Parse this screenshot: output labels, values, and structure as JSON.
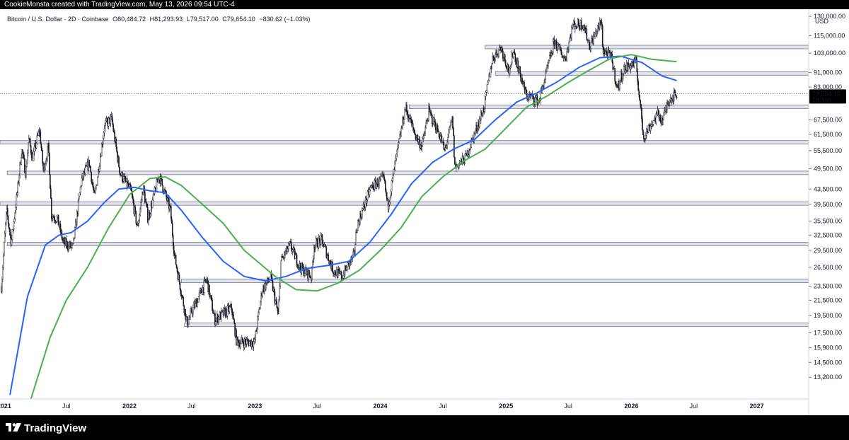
{
  "header": {
    "caption": "CookieMonsta created with TradingView.com, May 13, 2026 09:54 UTC-4"
  },
  "legend": {
    "symbol": "Bitcoin / U.S. Dollar · 2D · Coinbase",
    "open": "O80,484.72",
    "high": "H81,293.93",
    "low": "L79,517.00",
    "close": "C79,654.10",
    "change": "−830.62 (−1.03%)"
  },
  "price_scale": {
    "currency": "USD",
    "last_price": "79,654.10",
    "countdown": "1d 11h"
  },
  "footer": {
    "brand": "TradingView"
  },
  "colors": {
    "candle": "#131722",
    "ma_fast": "#2962ff",
    "ma_slow": "#4caf50",
    "level_fill": "#e0e3eb",
    "level_stroke": "#787b86",
    "badge": "#000000"
  },
  "chart_data": {
    "type": "candlestick",
    "scale": "log",
    "ylim": [
      11500,
      136000
    ],
    "xlim": [
      "2020-12-20",
      "2027-06-01"
    ],
    "y_ticks": [
      {
        "label": "130,000.00",
        "value": 130000
      },
      {
        "label": "115,000.00",
        "value": 115000
      },
      {
        "label": "103,000.00",
        "value": 103000
      },
      {
        "label": "91,000.00",
        "value": 91000
      },
      {
        "label": "83,000.00",
        "value": 83000
      },
      {
        "label": "67,500.00",
        "value": 67500
      },
      {
        "label": "61,500.00",
        "value": 61500
      },
      {
        "label": "55,500.00",
        "value": 55500
      },
      {
        "label": "49,500.00",
        "value": 49500
      },
      {
        "label": "43,500.00",
        "value": 43500
      },
      {
        "label": "39,500.00",
        "value": 39500
      },
      {
        "label": "35,500.00",
        "value": 35500
      },
      {
        "label": "32,500.00",
        "value": 32500
      },
      {
        "label": "29,500.00",
        "value": 29500
      },
      {
        "label": "26,500.00",
        "value": 26500
      },
      {
        "label": "23,500.00",
        "value": 23500
      },
      {
        "label": "21,500.00",
        "value": 21500
      },
      {
        "label": "19,500.00",
        "value": 19500
      },
      {
        "label": "17,500.00",
        "value": 17500
      },
      {
        "label": "15,900.00",
        "value": 15900
      },
      {
        "label": "14,500.00",
        "value": 14500
      },
      {
        "label": "13,200.00",
        "value": 13200
      }
    ],
    "x_ticks": [
      {
        "label": "2021",
        "date": "2021-01-01",
        "bold": true
      },
      {
        "label": "Jul",
        "date": "2021-07-01",
        "bold": false
      },
      {
        "label": "2022",
        "date": "2022-01-01",
        "bold": true
      },
      {
        "label": "Jul",
        "date": "2022-07-01",
        "bold": false
      },
      {
        "label": "2023",
        "date": "2023-01-01",
        "bold": true
      },
      {
        "label": "Jul",
        "date": "2023-07-01",
        "bold": false
      },
      {
        "label": "2024",
        "date": "2024-01-01",
        "bold": true
      },
      {
        "label": "Jul",
        "date": "2024-07-01",
        "bold": false
      },
      {
        "label": "2025",
        "date": "2025-01-01",
        "bold": true
      },
      {
        "label": "Jul",
        "date": "2025-07-01",
        "bold": false
      },
      {
        "label": "2026",
        "date": "2026-01-01",
        "bold": true
      },
      {
        "label": "Jul",
        "date": "2026-07-01",
        "bold": false
      },
      {
        "label": "2027",
        "date": "2027-01-01",
        "bold": true
      }
    ],
    "price_series": [
      [
        "2020-12-24",
        23500
      ],
      [
        "2021-01-08",
        38000
      ],
      [
        "2021-01-22",
        31000
      ],
      [
        "2021-02-10",
        44000
      ],
      [
        "2021-02-21",
        56000
      ],
      [
        "2021-03-05",
        48000
      ],
      [
        "2021-03-13",
        60000
      ],
      [
        "2021-03-25",
        53000
      ],
      [
        "2021-04-14",
        63500
      ],
      [
        "2021-04-25",
        49000
      ],
      [
        "2021-05-10",
        57000
      ],
      [
        "2021-05-19",
        37000
      ],
      [
        "2021-06-05",
        36000
      ],
      [
        "2021-06-22",
        31000
      ],
      [
        "2021-07-20",
        30000
      ],
      [
        "2021-08-14",
        46000
      ],
      [
        "2021-09-06",
        51500
      ],
      [
        "2021-09-21",
        41000
      ],
      [
        "2021-10-20",
        65000
      ],
      [
        "2021-11-10",
        68000
      ],
      [
        "2021-11-26",
        54000
      ],
      [
        "2021-12-05",
        48000
      ],
      [
        "2022-01-05",
        43000
      ],
      [
        "2022-01-24",
        34000
      ],
      [
        "2022-02-10",
        44000
      ],
      [
        "2022-02-24",
        36000
      ],
      [
        "2022-03-28",
        47500
      ],
      [
        "2022-04-30",
        38000
      ],
      [
        "2022-05-12",
        28500
      ],
      [
        "2022-06-18",
        18500
      ],
      [
        "2022-07-01",
        20000
      ],
      [
        "2022-08-14",
        24500
      ],
      [
        "2022-09-06",
        19000
      ],
      [
        "2022-10-25",
        20500
      ],
      [
        "2022-11-09",
        16500
      ],
      [
        "2022-12-31",
        16500
      ],
      [
        "2023-01-22",
        23000
      ],
      [
        "2023-02-16",
        24800
      ],
      [
        "2023-03-10",
        19500
      ],
      [
        "2023-03-18",
        27500
      ],
      [
        "2023-04-14",
        30500
      ],
      [
        "2023-05-12",
        26500
      ],
      [
        "2023-06-15",
        25000
      ],
      [
        "2023-06-22",
        30500
      ],
      [
        "2023-07-14",
        31500
      ],
      [
        "2023-08-17",
        26000
      ],
      [
        "2023-09-11",
        25000
      ],
      [
        "2023-10-16",
        28500
      ],
      [
        "2023-10-25",
        34500
      ],
      [
        "2023-12-05",
        44000
      ],
      [
        "2024-01-11",
        46500
      ],
      [
        "2024-01-23",
        39000
      ],
      [
        "2024-02-15",
        52000
      ],
      [
        "2024-03-14",
        73000
      ],
      [
        "2024-04-13",
        61000
      ],
      [
        "2024-05-01",
        57000
      ],
      [
        "2024-05-21",
        71000
      ],
      [
        "2024-06-25",
        60500
      ],
      [
        "2024-07-06",
        55000
      ],
      [
        "2024-07-29",
        68000
      ],
      [
        "2024-08-05",
        50000
      ],
      [
        "2024-09-06",
        53000
      ],
      [
        "2024-10-29",
        73000
      ],
      [
        "2024-11-22",
        99000
      ],
      [
        "2024-12-17",
        107000
      ],
      [
        "2025-01-13",
        90000
      ],
      [
        "2025-01-21",
        106000
      ],
      [
        "2025-02-28",
        79000
      ],
      [
        "2025-04-07",
        76000
      ],
      [
        "2025-05-22",
        111000
      ],
      [
        "2025-06-22",
        99000
      ],
      [
        "2025-07-14",
        123000
      ],
      [
        "2025-08-14",
        124000
      ],
      [
        "2025-09-01",
        108000
      ],
      [
        "2025-10-06",
        126000
      ],
      [
        "2025-10-10",
        105000
      ],
      [
        "2025-11-04",
        100000
      ],
      [
        "2025-11-21",
        82000
      ],
      [
        "2025-12-10",
        93000
      ],
      [
        "2026-01-14",
        97500
      ],
      [
        "2026-02-05",
        60500
      ],
      [
        "2026-03-01",
        66000
      ],
      [
        "2026-03-20",
        70000
      ],
      [
        "2026-04-01",
        67000
      ],
      [
        "2026-04-20",
        77000
      ],
      [
        "2026-05-13",
        79654
      ]
    ],
    "series": [
      {
        "color": "#2962ff",
        "points": [
          [
            "2021-01-18",
            11800
          ],
          [
            "2021-03-10",
            22000
          ],
          [
            "2021-05-01",
            30500
          ],
          [
            "2021-06-10",
            32500
          ],
          [
            "2021-07-15",
            33000
          ],
          [
            "2021-09-01",
            35500
          ],
          [
            "2021-10-20",
            40000
          ],
          [
            "2021-12-01",
            43500
          ],
          [
            "2022-01-15",
            44000
          ],
          [
            "2022-03-01",
            43000
          ],
          [
            "2022-04-15",
            42500
          ],
          [
            "2022-06-01",
            38000
          ],
          [
            "2022-08-01",
            32000
          ],
          [
            "2022-10-01",
            27500
          ],
          [
            "2022-12-01",
            25000
          ],
          [
            "2023-02-01",
            24300
          ],
          [
            "2023-04-01",
            25000
          ],
          [
            "2023-06-01",
            26300
          ],
          [
            "2023-08-01",
            26800
          ],
          [
            "2023-10-01",
            27500
          ],
          [
            "2023-12-01",
            31000
          ],
          [
            "2024-02-01",
            37000
          ],
          [
            "2024-04-01",
            45000
          ],
          [
            "2024-06-01",
            51500
          ],
          [
            "2024-08-01",
            56000
          ],
          [
            "2024-10-01",
            59500
          ],
          [
            "2024-12-01",
            67500
          ],
          [
            "2025-02-01",
            75500
          ],
          [
            "2025-04-01",
            80000
          ],
          [
            "2025-06-01",
            86000
          ],
          [
            "2025-08-01",
            94000
          ],
          [
            "2025-10-01",
            100000
          ],
          [
            "2025-12-01",
            101000
          ],
          [
            "2026-02-01",
            97000
          ],
          [
            "2026-04-01",
            89000
          ],
          [
            "2026-05-13",
            86500
          ]
        ]
      },
      {
        "color": "#4caf50",
        "points": [
          [
            "2021-03-20",
            11500
          ],
          [
            "2021-05-15",
            17000
          ],
          [
            "2021-07-01",
            21500
          ],
          [
            "2021-09-01",
            26500
          ],
          [
            "2021-11-01",
            34000
          ],
          [
            "2022-01-01",
            42000
          ],
          [
            "2022-03-01",
            46500
          ],
          [
            "2022-04-15",
            47000
          ],
          [
            "2022-06-01",
            44500
          ],
          [
            "2022-08-01",
            39500
          ],
          [
            "2022-10-01",
            35000
          ],
          [
            "2022-12-01",
            29500
          ],
          [
            "2023-03-01",
            25000
          ],
          [
            "2023-05-01",
            23000
          ],
          [
            "2023-07-01",
            22800
          ],
          [
            "2023-09-01",
            24000
          ],
          [
            "2023-11-01",
            26000
          ],
          [
            "2024-01-01",
            29500
          ],
          [
            "2024-03-01",
            34000
          ],
          [
            "2024-05-01",
            41500
          ],
          [
            "2024-07-01",
            47000
          ],
          [
            "2024-09-01",
            52000
          ],
          [
            "2024-11-01",
            56000
          ],
          [
            "2025-01-01",
            64000
          ],
          [
            "2025-03-01",
            73000
          ],
          [
            "2025-05-01",
            78500
          ],
          [
            "2025-07-01",
            85500
          ],
          [
            "2025-09-01",
            92500
          ],
          [
            "2025-11-01",
            99500
          ],
          [
            "2026-01-01",
            102000
          ],
          [
            "2026-03-01",
            99000
          ],
          [
            "2026-05-13",
            97500
          ]
        ]
      }
    ],
    "levels": [
      {
        "from": "2024-11-01",
        "value": 107000
      },
      {
        "from": "2024-12-01",
        "value": 90500
      },
      {
        "from": "2024-03-25",
        "value": 73300
      },
      {
        "from": "2020-12-20",
        "value": 58500
      },
      {
        "from": "2021-01-10",
        "value": 48200
      },
      {
        "from": "2020-12-20",
        "value": 39700
      },
      {
        "from": "2021-01-10",
        "value": 30700
      },
      {
        "from": "2022-06-01",
        "value": 24300
      },
      {
        "from": "2022-06-10",
        "value": 18400
      }
    ]
  }
}
